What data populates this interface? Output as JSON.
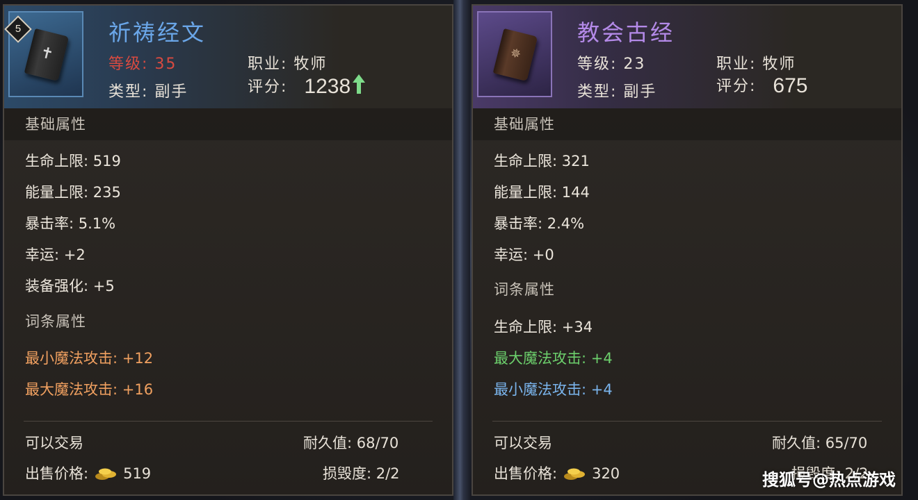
{
  "left": {
    "level_badge": "5",
    "title": "祈祷经文",
    "title_color": "#6aa6e8",
    "grade_label": "等级:",
    "grade_value": "35",
    "class_label": "职业:",
    "class_value": "牧师",
    "type_label": "类型:",
    "type_value": "副手",
    "score_label": "评分:",
    "score_value": "1238",
    "score_trend": "up-arrow-icon",
    "base_section": "基础属性",
    "base_attrs": [
      "生命上限: 519",
      "能量上限: 235",
      "暴击率: 5.1%",
      "幸运: +2",
      "装备强化: +5"
    ],
    "affix_section": "词条属性",
    "affix_attrs": [
      "最小魔法攻击: +12",
      "最大魔法攻击: +16"
    ],
    "affix_color": "#f0a060",
    "tradable": "可以交易",
    "price_label": "出售价格:",
    "price_value": "519",
    "durability": "耐久值: 68/70",
    "damage": "损毁度: 2/2"
  },
  "right": {
    "title": "教会古经",
    "title_color": "#b48ae8",
    "grade_label": "等级:",
    "grade_value": "23",
    "class_label": "职业:",
    "class_value": "牧师",
    "type_label": "类型:",
    "type_value": "副手",
    "score_label": "评分:",
    "score_value": "675",
    "base_section": "基础属性",
    "base_attrs": [
      "生命上限: 321",
      "能量上限: 144",
      "暴击率: 2.4%",
      "幸运: +0"
    ],
    "affix_section": "词条属性",
    "affix_attrs": [
      "生命上限: +34",
      "最大魔法攻击: +4",
      "最小魔法攻击: +4"
    ],
    "tradable": "可以交易",
    "price_label": "出售价格:",
    "price_value": "320",
    "durability": "耐久值: 65/70",
    "damage": "损毁度: 2/2"
  },
  "watermark": "搜狐号@热点游戏"
}
